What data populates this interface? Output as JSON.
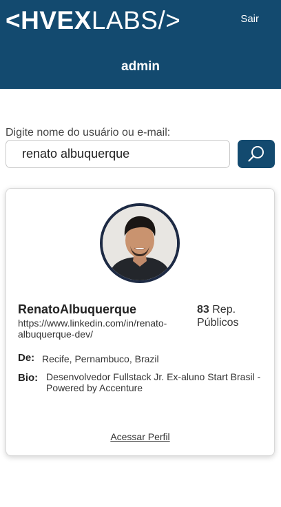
{
  "header": {
    "logo_bold": "<HVEX",
    "logo_light": "LABS/>",
    "logout_label": "Sair",
    "username": "admin",
    "background_color": "#134a6f"
  },
  "search": {
    "label": "Digite nome do usuário ou e-mail:",
    "value": "renato albuquerque",
    "button_icon": "search-icon"
  },
  "profile": {
    "avatar_icon": "user-photo",
    "name": "RenatoAlbuquerque",
    "link": "https://www.linkedin.com/in/renato-albuquerque-dev/",
    "repos_count": "83",
    "repos_label": "Rep. Públicos",
    "from_label": "De:",
    "from_value": "Recife, Pernambuco, Brazil",
    "bio_label": "Bio:",
    "bio_value": "Desenvolvedor Fullstack Jr. Ex-aluno Start Brasil - Powered by Accenture",
    "access_label": "Acessar Perfil"
  }
}
